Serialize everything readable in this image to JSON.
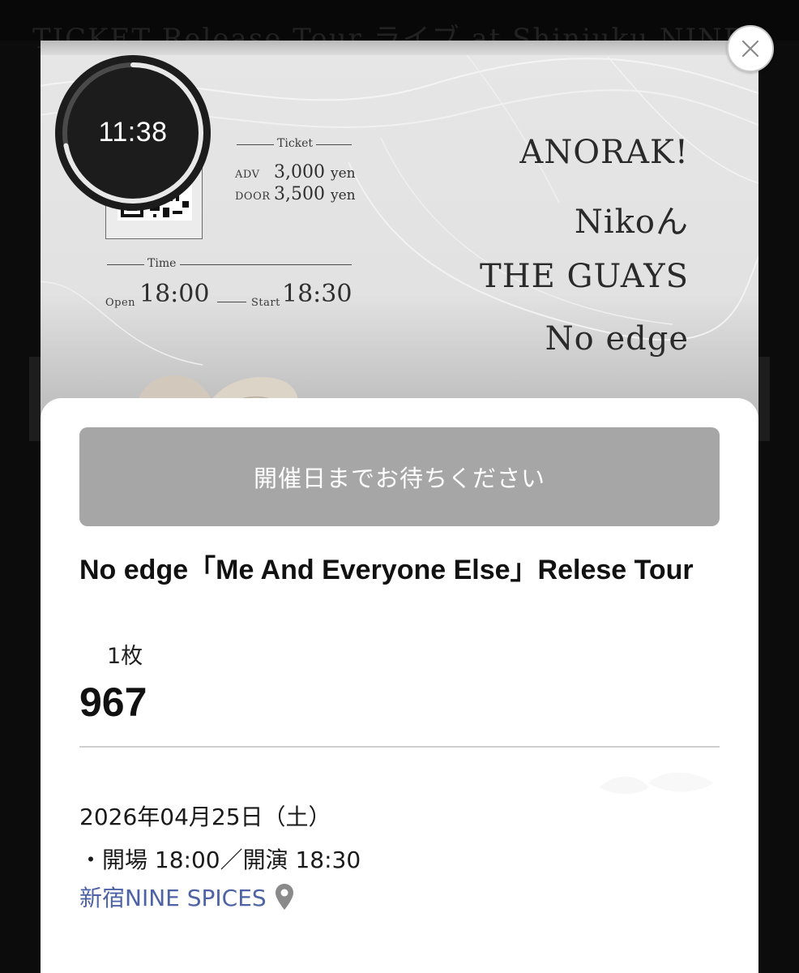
{
  "backdrop": {
    "ghost_text": "TICKET  Release Tour  ライブ at Shinjuku NINE SPICES"
  },
  "flyer": {
    "ticket_heading": "Ticket",
    "adv_label": "ADV",
    "adv_price": "3,000",
    "door_label": "DOOR",
    "door_price": "3,500",
    "price_unit": "yen",
    "time_heading": "Time",
    "open_label": "Open",
    "open_time": "18:00",
    "start_label": "Start",
    "start_time": "18:30",
    "artists": [
      "ANORAK!",
      "Nikoん",
      "THE GUAYS",
      "No edge"
    ]
  },
  "timer": {
    "label": "11:38",
    "remaining_fraction": 0.72
  },
  "close_button": {
    "icon": "close-icon"
  },
  "sheet": {
    "wait_button_label": "開催日までお待ちください",
    "event_title": "No edge「Me And Everyone Else」Relese Tour",
    "ticket_quantity": "1枚",
    "ticket_number": "967",
    "event_date": "2026年04月25日（土）",
    "event_times": "・開場 18:00／開演 18:30",
    "venue": "新宿NINE SPICES",
    "venue_icon": "map-pin-icon"
  },
  "colors": {
    "backdrop": "#0c0c0c",
    "wait_button_bg": "#a6a6a6",
    "venue_link": "#4e63a6",
    "pin": "#8a8a8a"
  }
}
